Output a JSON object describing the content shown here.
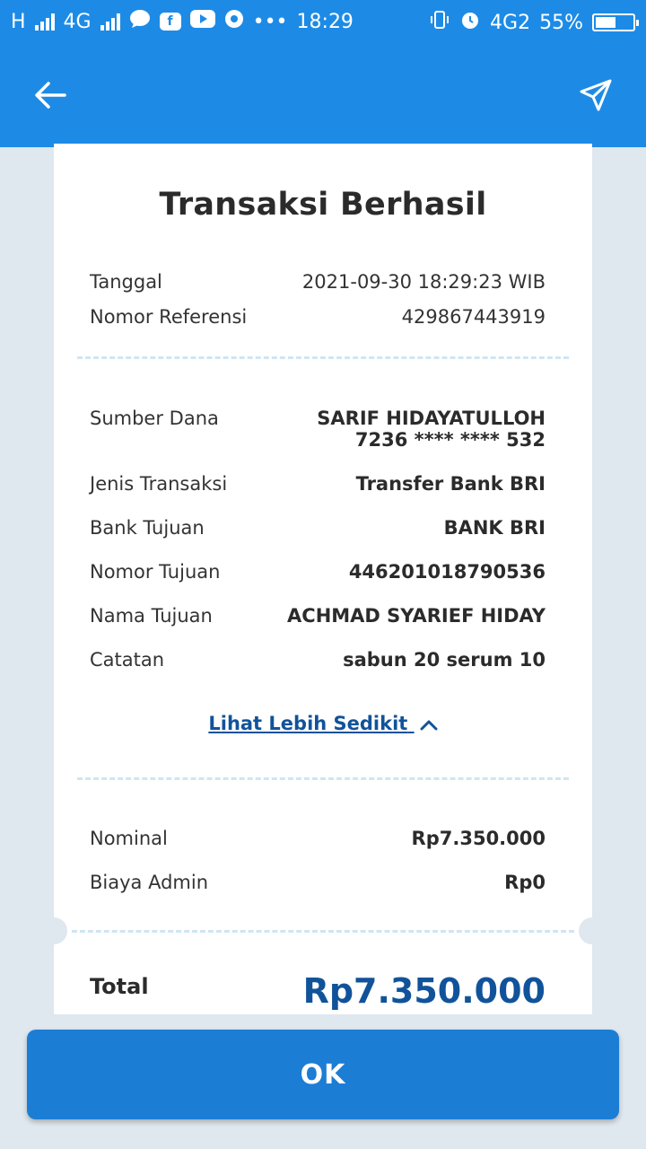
{
  "status_bar": {
    "network_left": "H",
    "network_type": "4G",
    "dots": "•••",
    "time": "18:29",
    "network_right": "4G2",
    "battery_percent": "55%",
    "battery_level": 0.55,
    "icons": [
      "signal-bars-icon",
      "message-icon",
      "facebook-icon",
      "youtube-icon",
      "chrome-icon",
      "vibrate-icon",
      "alarm-icon",
      "battery-icon"
    ]
  },
  "appbar": {
    "icons": [
      "arrow-left-icon",
      "send-icon"
    ]
  },
  "receipt": {
    "title": "Transaksi Berhasil",
    "tanggal_label": "Tanggal",
    "tanggal_value": "2021-09-30 18:29:23 WIB",
    "referensi_label": "Nomor Referensi",
    "referensi_value": "429867443919",
    "sumber_label": "Sumber Dana",
    "sumber_name": "SARIF HIDAYATULLOH",
    "sumber_account": "7236 **** **** 532",
    "jenis_label": "Jenis Transaksi",
    "jenis_value": "Transfer Bank BRI",
    "bank_label": "Bank Tujuan",
    "bank_value": "BANK BRI",
    "nomor_tujuan_label": "Nomor Tujuan",
    "nomor_tujuan_value": "446201018790536",
    "nama_tujuan_label": "Nama Tujuan",
    "nama_tujuan_value": "ACHMAD SYARIEF HIDAY",
    "catatan_label": "Catatan",
    "catatan_value": "sabun 20 serum 10",
    "toggle_label": "Lihat Lebih Sedikit",
    "nominal_label": "Nominal",
    "nominal_value": "Rp7.350.000",
    "biaya_label": "Biaya Admin",
    "biaya_value": "Rp0",
    "total_label": "Total",
    "total_value": "Rp7.350.000"
  },
  "ok_button": "OK",
  "colors": {
    "primary": "#1d8be6",
    "button": "#1c7dd4",
    "accent_text": "#11539a",
    "background": "#dfe7ef",
    "divider": "#cfe5f2"
  }
}
